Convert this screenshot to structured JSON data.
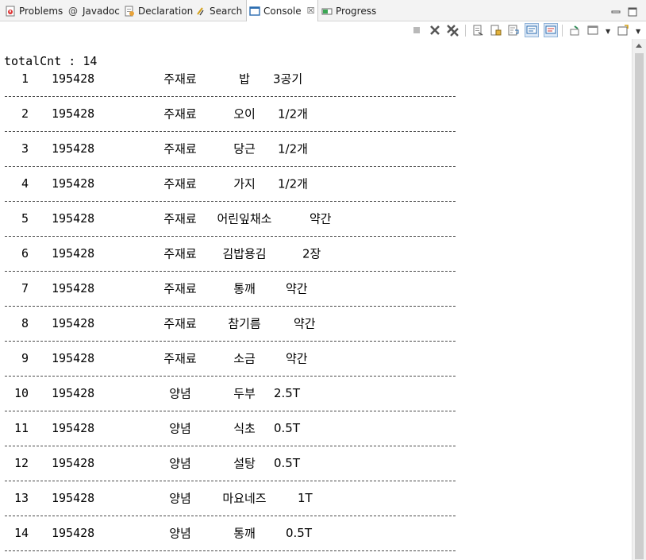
{
  "tabs": [
    {
      "label": "Problems",
      "icon": "problems-icon"
    },
    {
      "label": "Javadoc",
      "icon": "javadoc-at-icon"
    },
    {
      "label": "Declaration",
      "icon": "declaration-icon"
    },
    {
      "label": "Search",
      "icon": "search-icon"
    },
    {
      "label": "Console",
      "icon": "console-icon",
      "active": true,
      "close": "☒"
    },
    {
      "label": "Progress",
      "icon": "progress-icon"
    }
  ],
  "console": {
    "total_line": "totalCnt : 14",
    "rows": [
      {
        "num": "1",
        "code": "195428",
        "category": "주재료",
        "ingredient": "밥",
        "qty": "3공기"
      },
      {
        "num": "2",
        "code": "195428",
        "category": "주재료",
        "ingredient": "오이",
        "qty": "1/2개"
      },
      {
        "num": "3",
        "code": "195428",
        "category": "주재료",
        "ingredient": "당근",
        "qty": "1/2개"
      },
      {
        "num": "4",
        "code": "195428",
        "category": "주재료",
        "ingredient": "가지",
        "qty": "1/2개"
      },
      {
        "num": "5",
        "code": "195428",
        "category": "주재료",
        "ingredient": "어린잎채소",
        "qty": "약간"
      },
      {
        "num": "6",
        "code": "195428",
        "category": "주재료",
        "ingredient": "김밥용김",
        "qty": "2장"
      },
      {
        "num": "7",
        "code": "195428",
        "category": "주재료",
        "ingredient": "통깨",
        "qty": "약간"
      },
      {
        "num": "8",
        "code": "195428",
        "category": "주재료",
        "ingredient": "참기름",
        "qty": "약간"
      },
      {
        "num": "9",
        "code": "195428",
        "category": "주재료",
        "ingredient": "소금",
        "qty": "약간"
      },
      {
        "num": "10",
        "code": "195428",
        "category": "양념",
        "ingredient": "두부",
        "qty": "2.5T"
      },
      {
        "num": "11",
        "code": "195428",
        "category": "양념",
        "ingredient": "식초",
        "qty": "0.5T"
      },
      {
        "num": "12",
        "code": "195428",
        "category": "양념",
        "ingredient": "설탕",
        "qty": "0.5T"
      },
      {
        "num": "13",
        "code": "195428",
        "category": "양념",
        "ingredient": "마요네즈",
        "qty": "1T"
      },
      {
        "num": "14",
        "code": "195428",
        "category": "양념",
        "ingredient": "통깨",
        "qty": "0.5T"
      }
    ]
  },
  "toolbar": {
    "icons": [
      "terminate-icon",
      "remove-launch-icon",
      "remove-all-terminated-icon",
      "clear-console-icon",
      "scroll-lock-icon",
      "word-wrap-icon",
      "show-on-stdout-icon",
      "show-on-stderr-icon",
      "pin-console-icon",
      "display-selected-console-icon",
      "open-console-icon"
    ]
  },
  "colors": {
    "tab_bg": "#f3f3f3",
    "accent": "#2b6cb0",
    "pressed_bg": "#dce8f6"
  }
}
